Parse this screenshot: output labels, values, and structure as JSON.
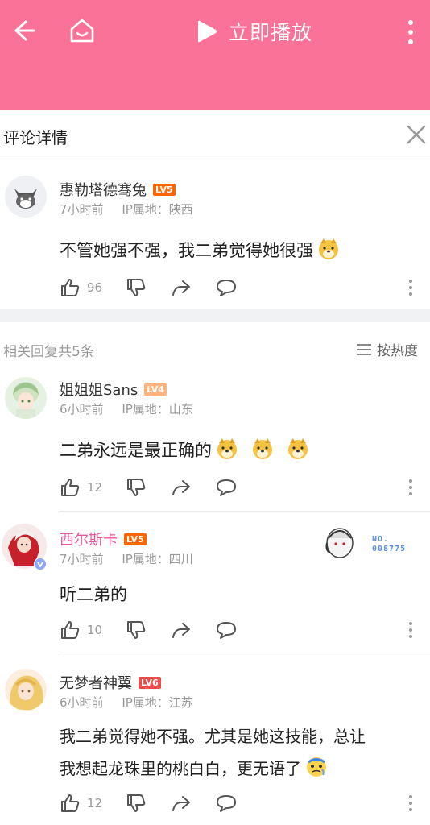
{
  "topbar": {
    "play_label": "立即播放",
    "bg_color": "#fb7299",
    "icons": [
      "back-arrow-icon",
      "home-icon",
      "play-icon",
      "more-vertical-icon"
    ]
  },
  "detail": {
    "title": "评论详情",
    "close_icon": "close-icon"
  },
  "main_comment": {
    "username": "惠勒塔德骞兔",
    "level": "LV5",
    "time": "7小时前",
    "ip": "IP属地：陕西",
    "text": "不管她强不强，我二弟觉得她很强",
    "likes": "96"
  },
  "related": {
    "label": "相关回复共5条",
    "sort_label": "按热度"
  },
  "replies": [
    {
      "username": "姐姐姐Sans",
      "level": "LV4",
      "time": "6小时前",
      "ip": "IP属地：山东",
      "text": "二弟永远是最正确的",
      "likes": "12"
    },
    {
      "username": "西尔斯卡",
      "level": "LV5",
      "time": "7小时前",
      "ip": "IP属地：四川",
      "text": "听二弟的",
      "likes": "10",
      "badge_text": "NO.\n008775"
    },
    {
      "username": "无梦者神翼",
      "level": "LV6",
      "time": "6小时前",
      "ip": "IP属地：江苏",
      "text_line1": "我二弟觉得她不强。尤其是她这技能，总让",
      "text_line2": "我想起龙珠里的桃白白，更无语了",
      "likes": "12"
    }
  ]
}
